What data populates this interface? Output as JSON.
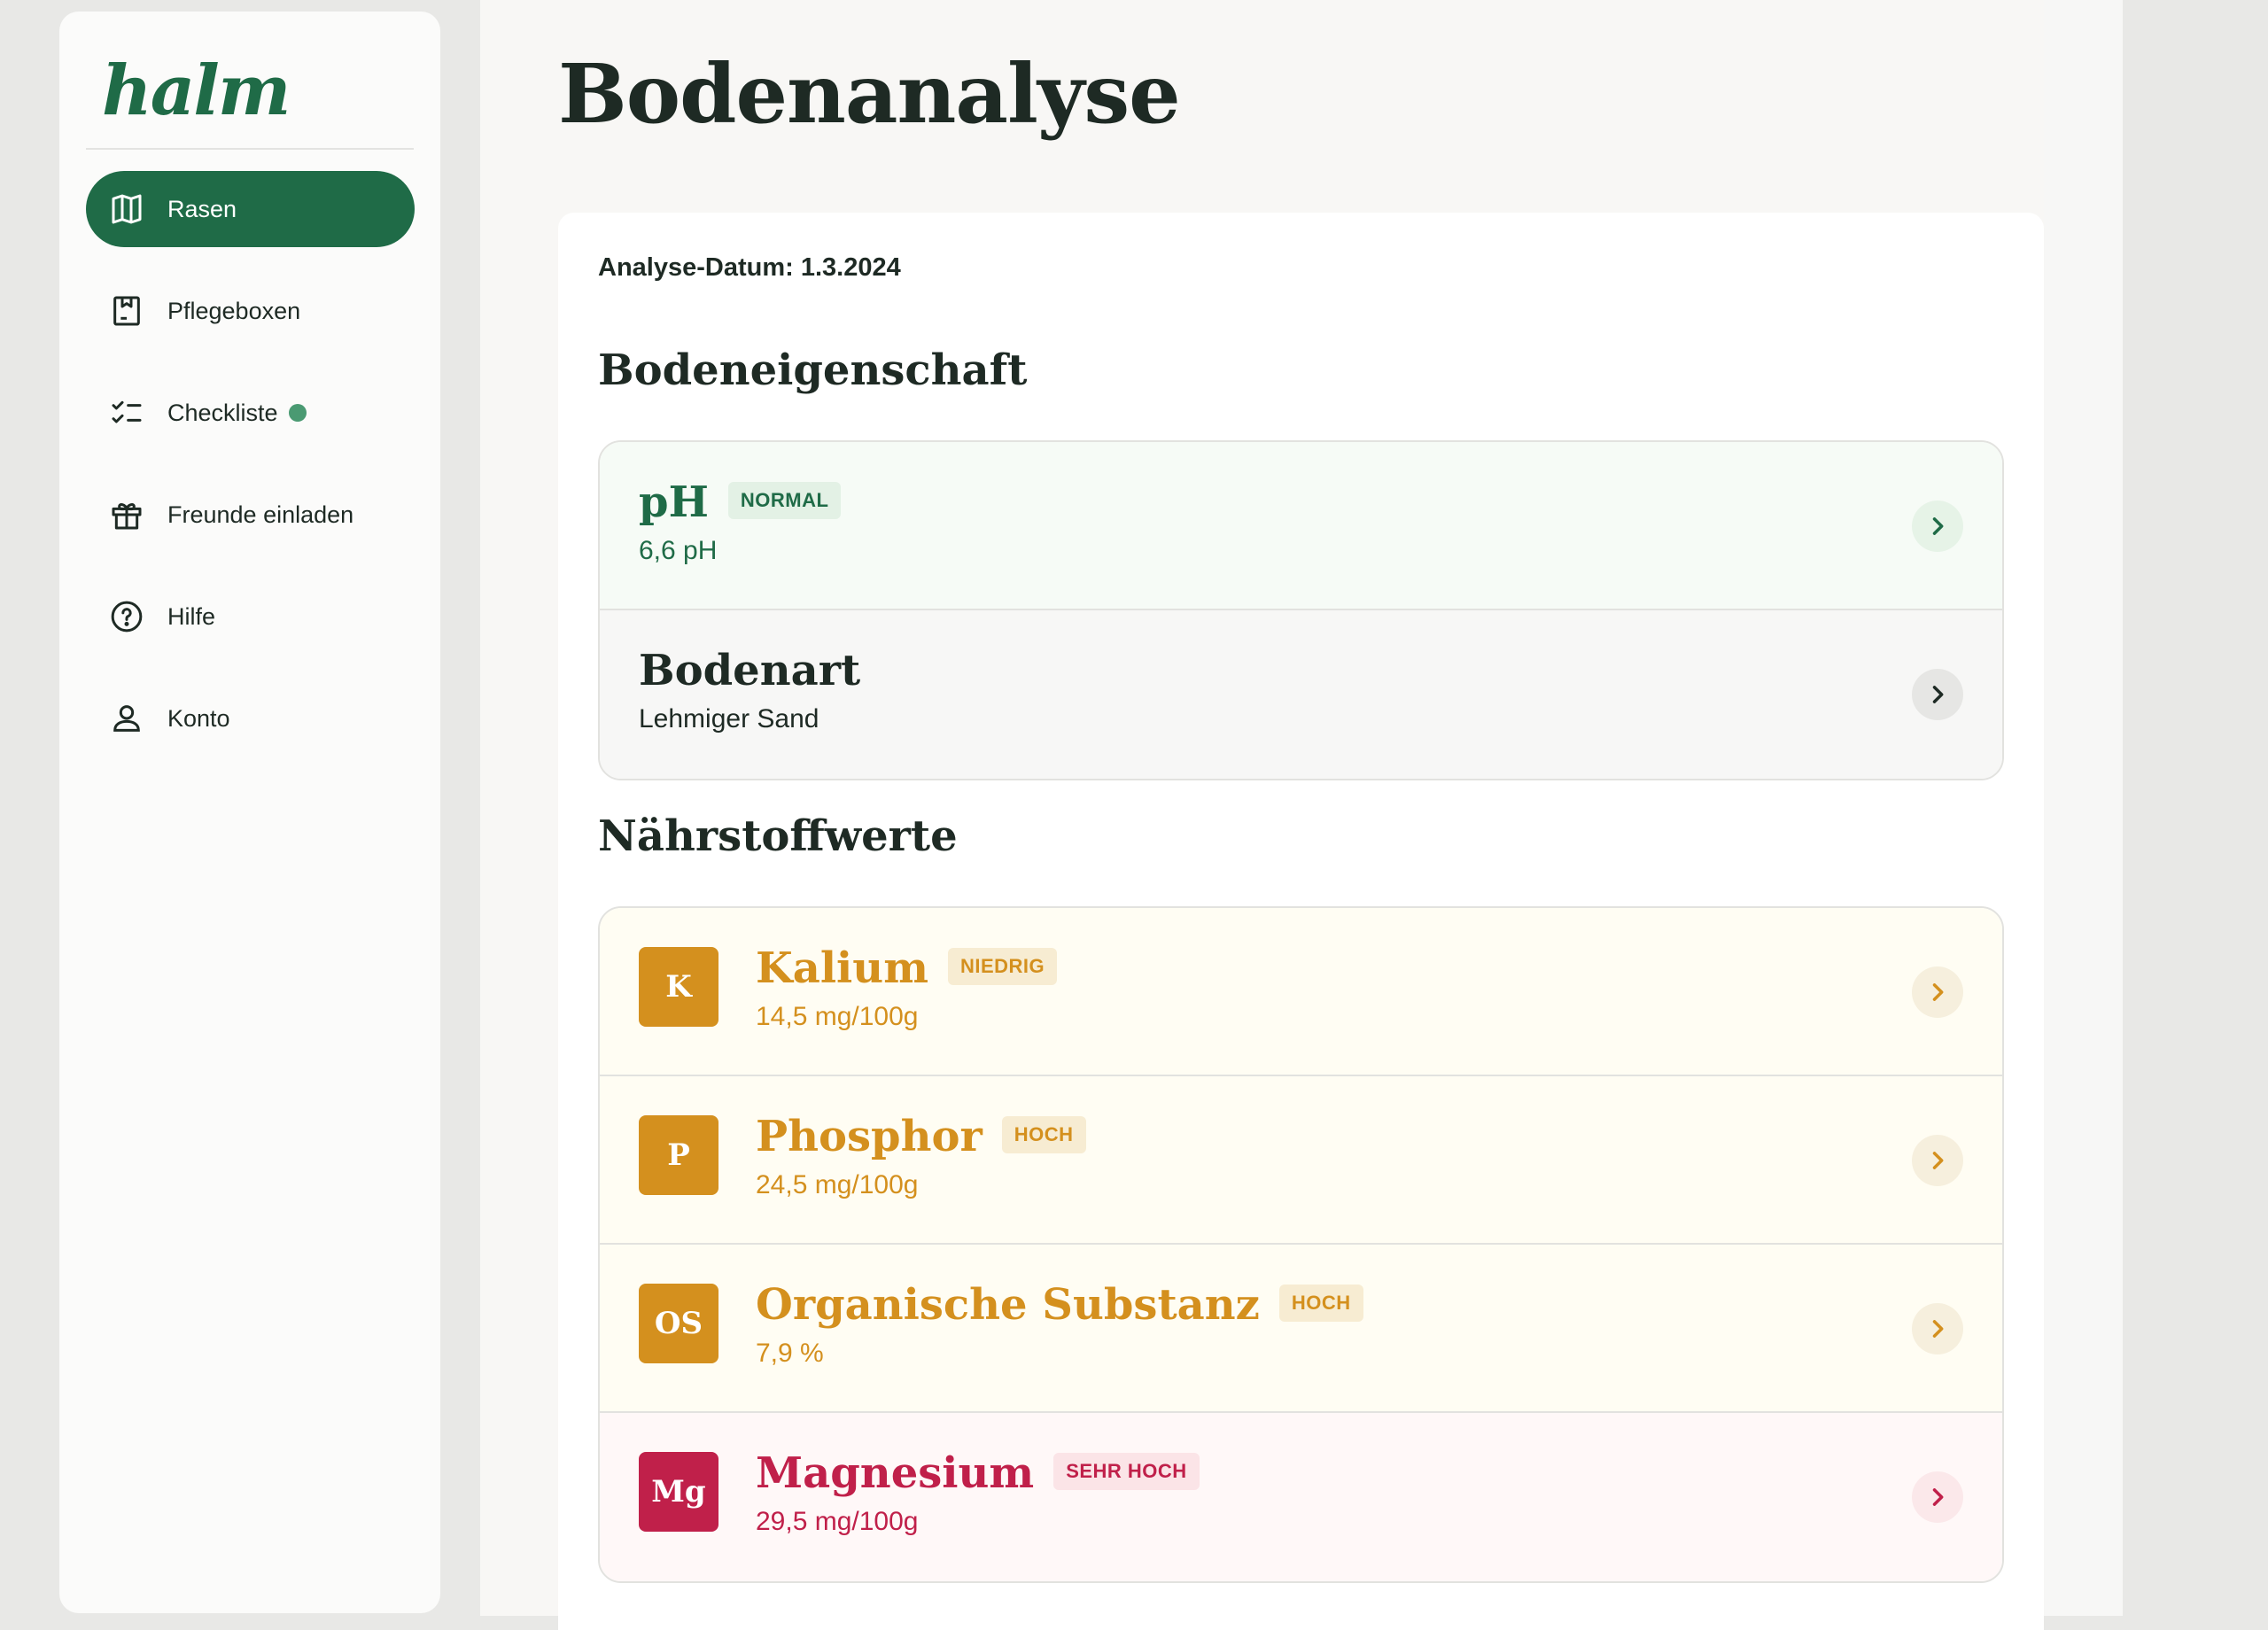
{
  "app": {
    "logo": "halm"
  },
  "sidebar": {
    "items": [
      {
        "label": "Rasen",
        "icon": "map-icon",
        "active": true
      },
      {
        "label": "Pflegeboxen",
        "icon": "box-icon",
        "active": false
      },
      {
        "label": "Checkliste",
        "icon": "checklist-icon",
        "active": false,
        "dot_color": "#4a9a72"
      },
      {
        "label": "Freunde einladen",
        "icon": "gift-icon",
        "active": false
      },
      {
        "label": "Hilfe",
        "icon": "help-circle-icon",
        "active": false
      },
      {
        "label": "Konto",
        "icon": "user-icon",
        "active": false
      }
    ]
  },
  "page": {
    "title": "Bodenanalyse",
    "analysis_date": "Analyse-Datum: 1.3.2024"
  },
  "soil": {
    "title": "Bodeneigenschaft",
    "items": [
      {
        "name": "pH",
        "badge": "NORMAL",
        "value": "6,6 pH",
        "color": "#1f6b47",
        "bg": "#f6fbf6",
        "badge_bg": "#e3f1e5",
        "chev_bg": "#e6f3e7"
      },
      {
        "name": "Bodenart",
        "badge": "",
        "value": "Lehmiger Sand",
        "color": "#1e2a24",
        "bg": "#f7f7f6",
        "badge_bg": "",
        "chev_bg": "#e6e6e4"
      }
    ]
  },
  "nutrients": {
    "title": "Nährstoffwerte",
    "items": [
      {
        "symbol": "K",
        "name": "Kalium",
        "badge": "NIEDRIG",
        "value": "14,5 mg/100g",
        "color": "#d4901e",
        "bg": "#fffdf3",
        "badge_bg": "#f7ecd2",
        "chev_bg": "#f6efdd"
      },
      {
        "symbol": "P",
        "name": "Phosphor",
        "badge": "HOCH",
        "value": "24,5 mg/100g",
        "color": "#d4901e",
        "bg": "#fffdf3",
        "badge_bg": "#f7ecd2",
        "chev_bg": "#f6efdd"
      },
      {
        "symbol": "OS",
        "name": "Organische Substanz",
        "badge": "HOCH",
        "value": "7,9 %",
        "color": "#d4901e",
        "bg": "#fffdf3",
        "badge_bg": "#f7ecd2",
        "chev_bg": "#f6efdd"
      },
      {
        "symbol": "Mg",
        "name": "Magnesium",
        "badge": "SEHR HOCH",
        "value": "29,5 mg/100g",
        "color": "#c0204a",
        "bg": "#fff8f8",
        "badge_bg": "#fbe4e7",
        "chev_bg": "#fbe8ea"
      }
    ]
  }
}
